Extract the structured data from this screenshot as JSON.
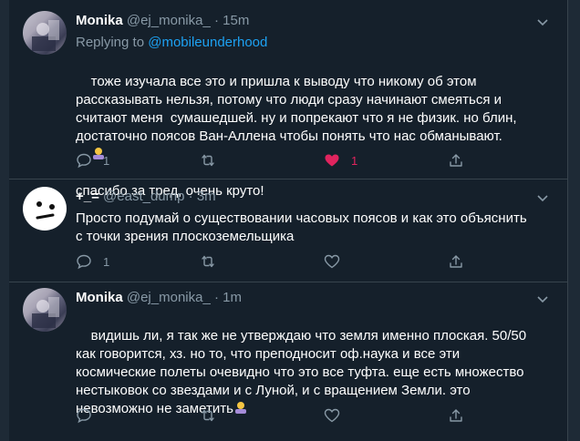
{
  "tweets": [
    {
      "author_name": "Monika",
      "author_handle": "@ej_monika_",
      "separator": "·",
      "time": "15m",
      "replying_prefix": "Replying to ",
      "replying_to": "@mobileunderhood",
      "text": "тоже изучала все это и пришла к выводу что никому об этом\nрассказывать нельзя, потому что люди сразу начинают смеяться и\nсчитают меня  сумашедшей. ну и попрекают что я не физик. но блин,\nдостаточно поясов Ван-Аллена чтобы понять что нас обманывают.",
      "text_tail": "спасибо за тред, очень круто!",
      "reply_count": "1",
      "retweet_count": "",
      "like_count": "1",
      "liked": true,
      "avatar_icon": "profile-photo-icon"
    },
    {
      "author_name": "+_=",
      "author_handle": "@east_dump",
      "separator": "·",
      "time": "3m",
      "text": "Просто подумай о существовании часовых поясов и как это объяснить\nс точки зрения плоскоземельщика",
      "reply_count": "1",
      "retweet_count": "",
      "like_count": "",
      "liked": false,
      "avatar_icon": "meh-face-icon"
    },
    {
      "author_name": "Monika",
      "author_handle": "@ej_monika_",
      "separator": "·",
      "time": "1m",
      "text": "видишь ли, я так же не утверждаю что земля именно плоская. 50/50\nкак говорится, хз. но то, что преподносит оф.наука и все эти\nкосмические полеты очевидно что это все туфта. еще есть множество\nнестыковок со звездами и с Луной, и с вращением Земли. это\nневозможно не заметить",
      "reply_count": "",
      "retweet_count": "",
      "like_count": "",
      "liked": false,
      "avatar_icon": "profile-photo-icon"
    }
  ],
  "colors": {
    "background": "#15202b",
    "text": "#ffffff",
    "muted": "#8899a6",
    "link": "#1da1f2",
    "like": "#e0245e",
    "border": "#38444d"
  }
}
